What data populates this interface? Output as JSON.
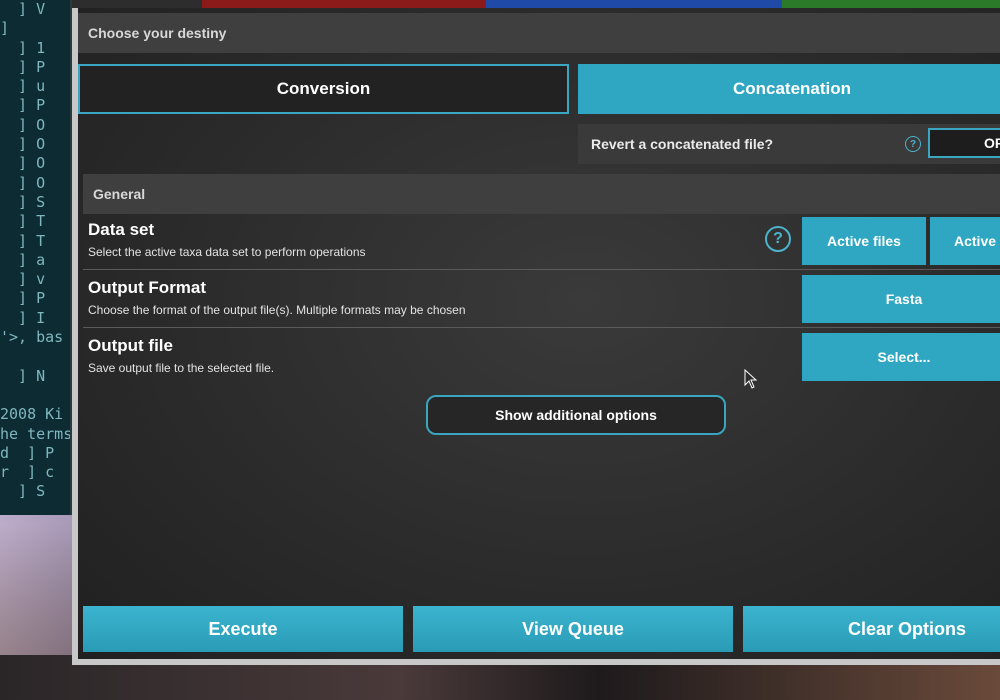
{
  "terminal": {
    "lines": [
      "  ] V",
      "]",
      "  ] 1",
      "  ] P",
      "  ] u",
      "  ] P",
      "  ] O",
      "  ] O",
      "  ] O",
      "  ] O",
      "  ] S",
      "  ] T",
      "  ] T",
      "  ] a",
      "  ] v",
      "  ] P",
      "  ] I",
      "'>, bas",
      "",
      "  ] N",
      "",
      "2008 Ki",
      "he terms",
      "d  ] P",
      "r  ] c",
      "  ] S"
    ]
  },
  "top_strip_colors": [
    "#2d2d2d",
    "#8b1a1a",
    "#1f4aa8",
    "#2a7a2a"
  ],
  "destiny": {
    "header": "Choose your destiny",
    "conversion_label": "Conversion",
    "concatenation_label": "Concatenation",
    "revert_label": "Revert a concatenated file?",
    "help_glyph": "?",
    "revert_toggle": "OF"
  },
  "general": {
    "header": "General",
    "dataset": {
      "title": "Data set",
      "description": "Select the active taxa data set to perform operations",
      "help_glyph": "?",
      "buttons": [
        "Active files",
        "Active"
      ]
    },
    "output_format": {
      "title": "Output Format",
      "description": "Choose the format of the output file(s). Multiple formats may be chosen",
      "button": "Fasta"
    },
    "output_file": {
      "title": "Output file",
      "description": "Save output file to the selected file.",
      "button": "Select..."
    },
    "show_more_label": "Show additional options"
  },
  "actions": {
    "execute": "Execute",
    "view_queue": "View Queue",
    "clear_options": "Clear Options"
  },
  "colors": {
    "accent": "#30a7c2",
    "panel": "#2d2d2d",
    "section_bar": "#3f3f3f"
  }
}
